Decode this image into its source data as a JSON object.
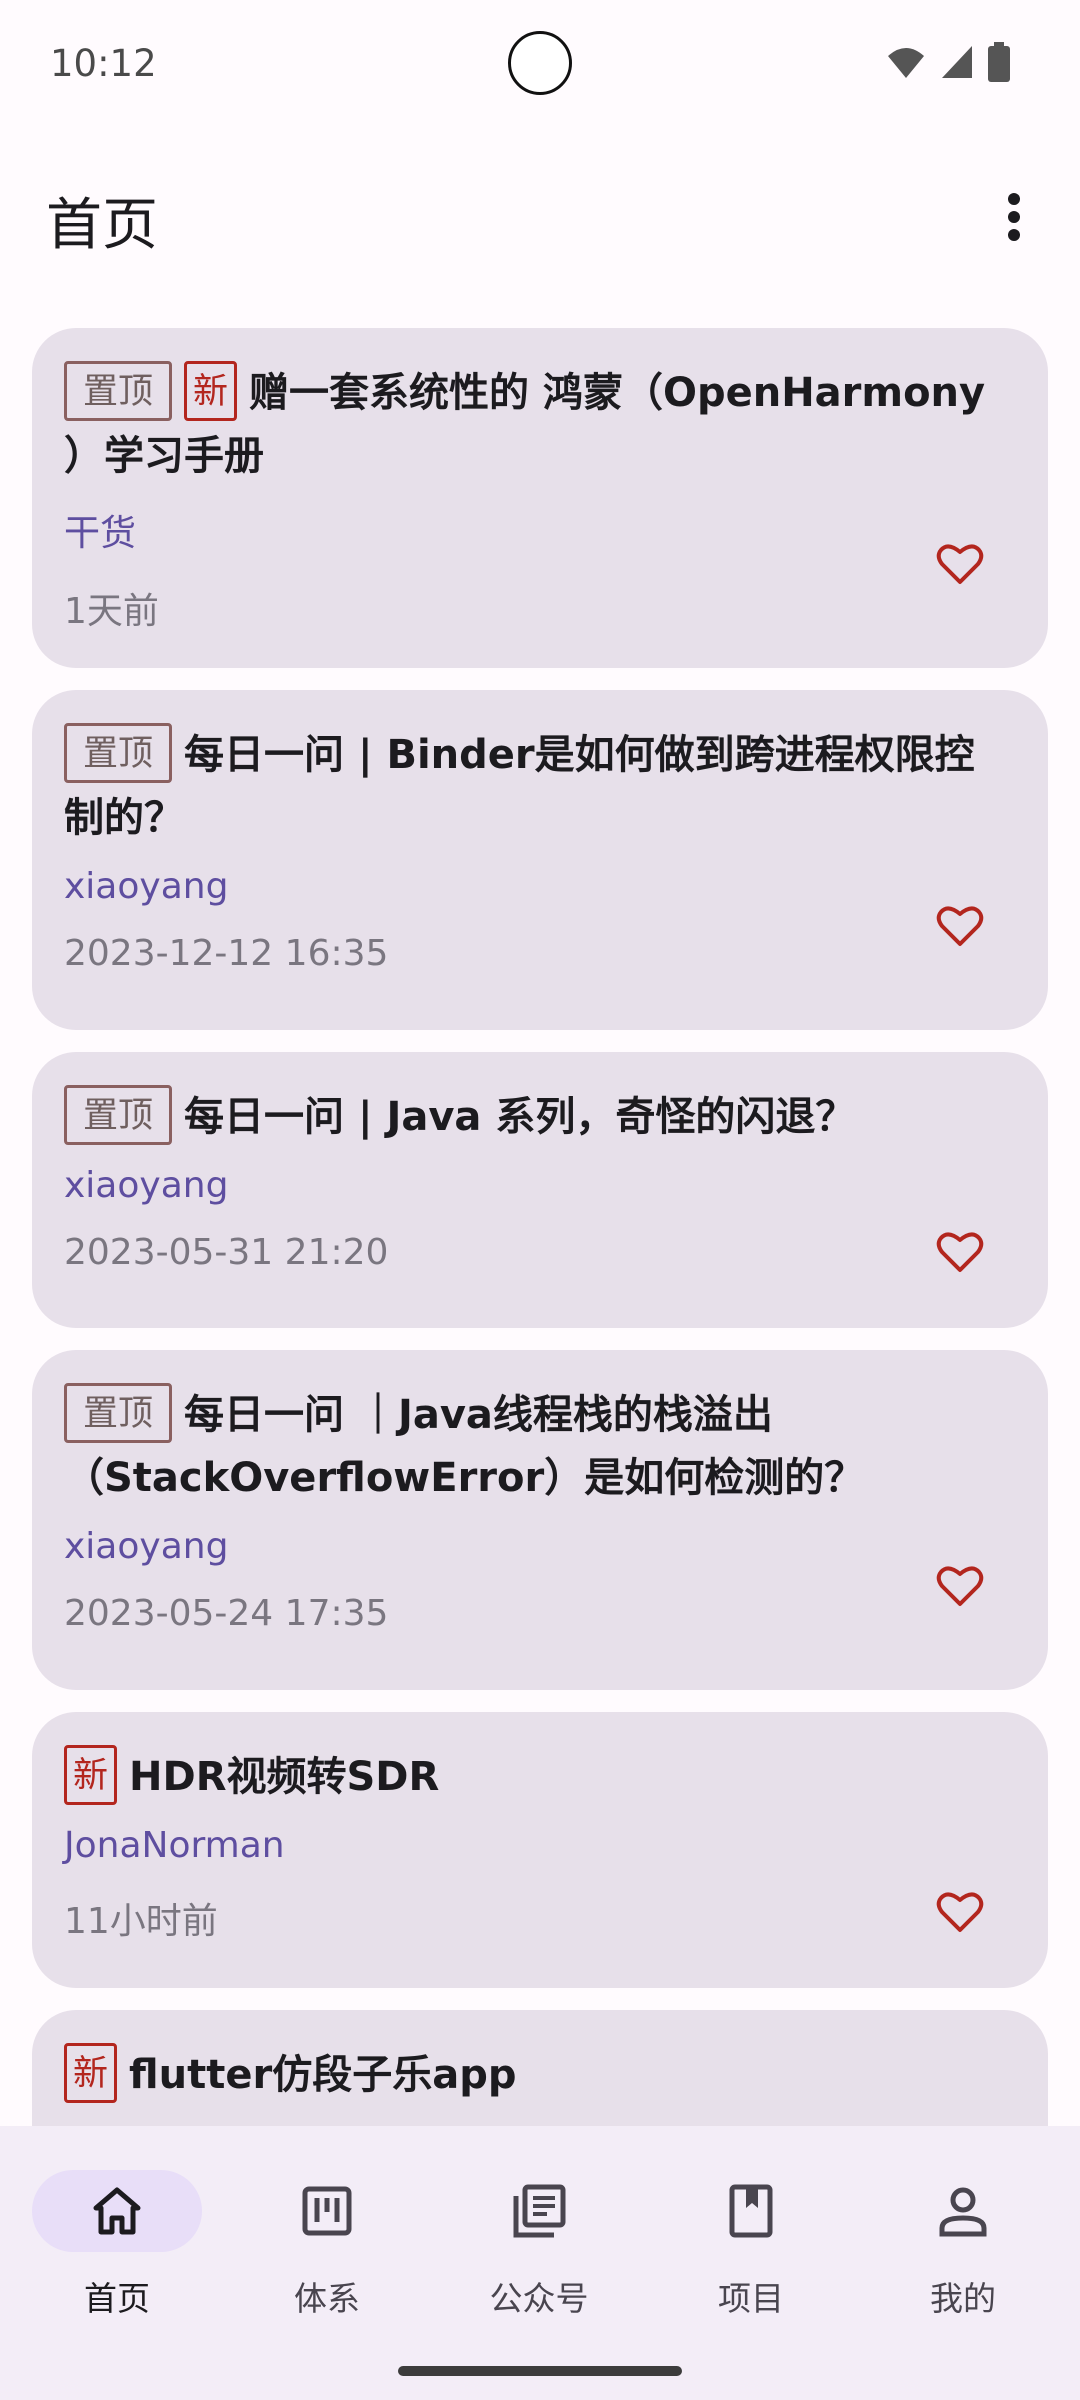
{
  "status_bar": {
    "time": "10:12"
  },
  "app_bar": {
    "title": "首页"
  },
  "articles": [
    {
      "tags": [
        "置顶",
        "新"
      ],
      "title": "赠一套系统性的 鸿蒙（OpenHarmony ）学习手册",
      "author": "干货",
      "time": "1天前"
    },
    {
      "tags": [
        "置顶"
      ],
      "title": "每日一问 | Binder是如何做到跨进程权限控制的？",
      "author": "xiaoyang",
      "time": "2023-12-12 16:35"
    },
    {
      "tags": [
        "置顶"
      ],
      "title": "每日一问 | Java 系列，奇怪的闪退？",
      "author": "xiaoyang",
      "time": "2023-05-31 21:20"
    },
    {
      "tags": [
        "置顶"
      ],
      "title": "每日一问 ｜Java线程栈的栈溢出（StackOverflowError）是如何检测的？",
      "author": "xiaoyang",
      "time": "2023-05-24 17:35"
    },
    {
      "tags": [
        "新"
      ],
      "title": "HDR视频转SDR",
      "author": "JonaNorman",
      "time": "11小时前"
    },
    {
      "tags": [
        "新"
      ],
      "title": "flutter仿段子乐app",
      "author": "",
      "time": ""
    }
  ],
  "bottom_nav": {
    "items": [
      {
        "label": "首页",
        "icon": "home-icon",
        "active": true
      },
      {
        "label": "体系",
        "icon": "system-icon",
        "active": false
      },
      {
        "label": "公众号",
        "icon": "articles-icon",
        "active": false
      },
      {
        "label": "项目",
        "icon": "bookmark-icon",
        "active": false
      },
      {
        "label": "我的",
        "icon": "person-icon",
        "active": false
      }
    ]
  },
  "colors": {
    "accent": "#5e4ea0",
    "card": "#e7e0ea",
    "favorite": "#b3261e",
    "nav_active": "#e8def8"
  }
}
